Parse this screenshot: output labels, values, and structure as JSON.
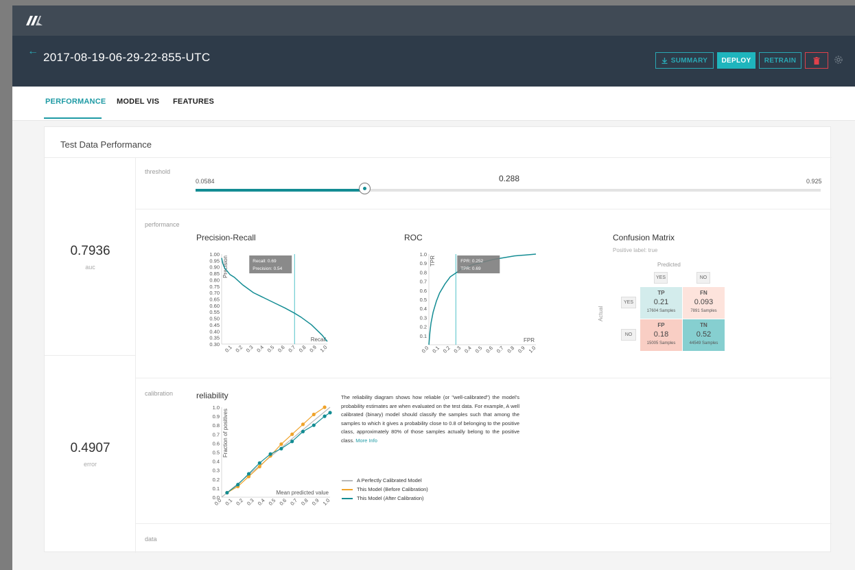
{
  "app": {
    "logo": "logo-mark"
  },
  "header": {
    "title": "2017-08-19-06-29-22-855-UTC",
    "back_icon": "back-arrow-icon",
    "summary_label": "SUMMARY",
    "deploy_label": "DEPLOY",
    "retrain_label": "RETRAIN",
    "delete_icon": "trash-icon",
    "settings_icon": "gear-icon"
  },
  "tabs": [
    {
      "label": "PERFORMANCE",
      "active": true
    },
    {
      "label": "MODEL VIS",
      "active": false
    },
    {
      "label": "FEATURES",
      "active": false
    }
  ],
  "card": {
    "title": "Test Data Performance",
    "metrics": [
      {
        "value": "0.7936",
        "label": "auc"
      },
      {
        "value": "0.4907",
        "label": "error"
      }
    ],
    "sections": {
      "threshold": "threshold",
      "performance": "performance",
      "calibration": "calibration",
      "data": "data"
    },
    "threshold": {
      "min": "0.0584",
      "value": "0.288",
      "max": "0.925",
      "position_fraction": 0.27
    }
  },
  "colors": {
    "accent": "#1e9aa4",
    "teal_dark": "#138c93",
    "orange": "#f0a32a",
    "gray_line": "#b8b8b8",
    "header_dark": "#2e3b49",
    "delete": "#e0414b"
  },
  "chart_data": [
    {
      "type": "line",
      "title": "Precision-Recall",
      "xlabel": "Recall",
      "ylabel": "Precision",
      "xlim": [
        0.0,
        1.0
      ],
      "ylim": [
        0.3,
        1.0
      ],
      "x_ticks": [
        "0.1",
        "0.2",
        "0.3",
        "0.4",
        "0.5",
        "0.6",
        "0.7",
        "0.8",
        "0.9",
        "1.0"
      ],
      "y_ticks": [
        "1.00",
        "0.95",
        "0.90",
        "0.85",
        "0.80",
        "0.75",
        "0.70",
        "0.65",
        "0.60",
        "0.55",
        "0.50",
        "0.45",
        "0.40",
        "0.35",
        "0.30"
      ],
      "series": [
        {
          "x": [
            0.0,
            0.01,
            0.02,
            0.03,
            0.05,
            0.08,
            0.12,
            0.2,
            0.3,
            0.4,
            0.5,
            0.6,
            0.69,
            0.75,
            0.85,
            0.95,
            1.0
          ],
          "y": [
            0.97,
            0.93,
            0.91,
            0.89,
            0.87,
            0.84,
            0.82,
            0.76,
            0.7,
            0.66,
            0.62,
            0.58,
            0.54,
            0.51,
            0.45,
            0.37,
            0.32
          ]
        }
      ],
      "marker_x": 0.69,
      "tooltip": [
        "Recall: 0.69",
        "Precision: 0.54"
      ]
    },
    {
      "type": "line",
      "title": "ROC",
      "xlabel": "FPR",
      "ylabel": "TPR",
      "xlim": [
        0.0,
        1.0
      ],
      "ylim": [
        0.0,
        1.0
      ],
      "x_ticks": [
        "0.0",
        "0.1",
        "0.2",
        "0.3",
        "0.4",
        "0.5",
        "0.6",
        "0.7",
        "0.8",
        "0.9",
        "1.0"
      ],
      "y_ticks": [
        "1.0",
        "0.9",
        "0.8",
        "0.7",
        "0.6",
        "0.5",
        "0.4",
        "0.3",
        "0.2",
        "0.1"
      ],
      "series": [
        {
          "x": [
            0.0,
            0.01,
            0.02,
            0.04,
            0.07,
            0.1,
            0.15,
            0.2,
            0.25,
            0.3,
            0.4,
            0.5,
            0.6,
            0.7,
            0.8,
            0.9,
            1.0
          ],
          "y": [
            0.0,
            0.14,
            0.24,
            0.36,
            0.48,
            0.57,
            0.67,
            0.75,
            0.79,
            0.83,
            0.88,
            0.91,
            0.94,
            0.96,
            0.98,
            0.99,
            1.0
          ]
        }
      ],
      "marker_x": 0.252,
      "tooltip": [
        "FPR: 0.252",
        "TPR: 0.69"
      ]
    },
    {
      "type": "table",
      "title": "Confusion Matrix",
      "subtitle": "Positive label: true",
      "predicted_label": "Predicted",
      "actual_label": "Actual",
      "columns": [
        "YES",
        "NO"
      ],
      "rows": [
        "YES",
        "NO"
      ],
      "cells": [
        [
          {
            "key": "TP",
            "value": "0.21",
            "samples": "17604 Samples",
            "color": "#d3ecec"
          },
          {
            "key": "FN",
            "value": "0.093",
            "samples": "7891 Samples",
            "color": "#fde3dc"
          }
        ],
        [
          {
            "key": "FP",
            "value": "0.18",
            "samples": "15005 Samples",
            "color": "#f9cec4"
          },
          {
            "key": "TN",
            "value": "0.52",
            "samples": "44549 Samples",
            "color": "#86cfd0"
          }
        ]
      ]
    },
    {
      "type": "line",
      "title": "reliability",
      "xlabel": "Mean predicted value",
      "ylabel": "Fraction of positives",
      "xlim": [
        0.0,
        1.0
      ],
      "ylim": [
        0.0,
        1.0
      ],
      "x_ticks": [
        "0.0",
        "0.1",
        "0.2",
        "0.3",
        "0.4",
        "0.5",
        "0.6",
        "0.7",
        "0.8",
        "0.9",
        "1.0"
      ],
      "y_ticks": [
        "1.0",
        "0.9",
        "0.8",
        "0.7",
        "0.6",
        "0.5",
        "0.4",
        "0.3",
        "0.2",
        "0.1",
        "0.0"
      ],
      "series": [
        {
          "name": "A Perfectly Calibrated Model",
          "color": "#b8b8b8",
          "x": [
            0.0,
            1.0
          ],
          "y": [
            0.0,
            1.0
          ]
        },
        {
          "name": "This Model (Before Calibration)",
          "color": "#f0a32a",
          "x": [
            0.05,
            0.15,
            0.25,
            0.35,
            0.45,
            0.55,
            0.65,
            0.75,
            0.85,
            0.95
          ],
          "y": [
            0.05,
            0.12,
            0.23,
            0.34,
            0.46,
            0.59,
            0.7,
            0.81,
            0.92,
            1.0
          ]
        },
        {
          "name": "This Model (After Calibration)",
          "color": "#138c93",
          "x": [
            0.05,
            0.15,
            0.25,
            0.35,
            0.45,
            0.55,
            0.65,
            0.75,
            0.85,
            0.95,
            1.0
          ],
          "y": [
            0.05,
            0.14,
            0.26,
            0.38,
            0.48,
            0.54,
            0.62,
            0.73,
            0.8,
            0.9,
            0.94
          ]
        }
      ],
      "description": "The reliability diagram shows how reliable (or \"well-calibrated\") the model's probability estimates are when evaluated on the test data. For example, A well calibrated (binary) model should classify the samples such that among the samples to which it gives a probability close to 0.8 of belonging to the positive class, approximately 80% of those samples actually belong to the positive class.",
      "more_info": "More Info"
    }
  ]
}
